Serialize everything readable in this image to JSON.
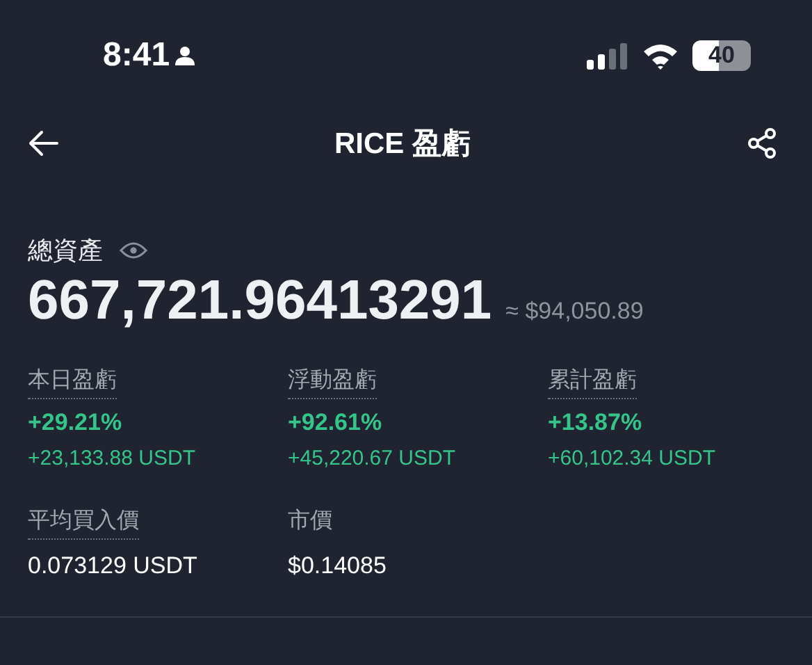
{
  "status_bar": {
    "time": "8:41",
    "battery": "40"
  },
  "nav": {
    "title": "RICE 盈虧"
  },
  "total": {
    "label": "總資產",
    "value": "667,721.96413291",
    "approx": "≈ $94,050.89"
  },
  "stats": [
    {
      "label": "本日盈虧",
      "underlined": true,
      "percent": "+29.21%",
      "amount": "+23,133.88 USDT"
    },
    {
      "label": "浮動盈虧",
      "underlined": true,
      "percent": "+92.61%",
      "amount": "+45,220.67 USDT"
    },
    {
      "label": "累計盈虧",
      "underlined": true,
      "percent": "+13.87%",
      "amount": "+60,102.34 USDT"
    }
  ],
  "prices": [
    {
      "label": "平均買入價",
      "underlined": true,
      "value": "0.073129 USDT"
    },
    {
      "label": "市價",
      "underlined": false,
      "value": "$0.14085"
    }
  ]
}
